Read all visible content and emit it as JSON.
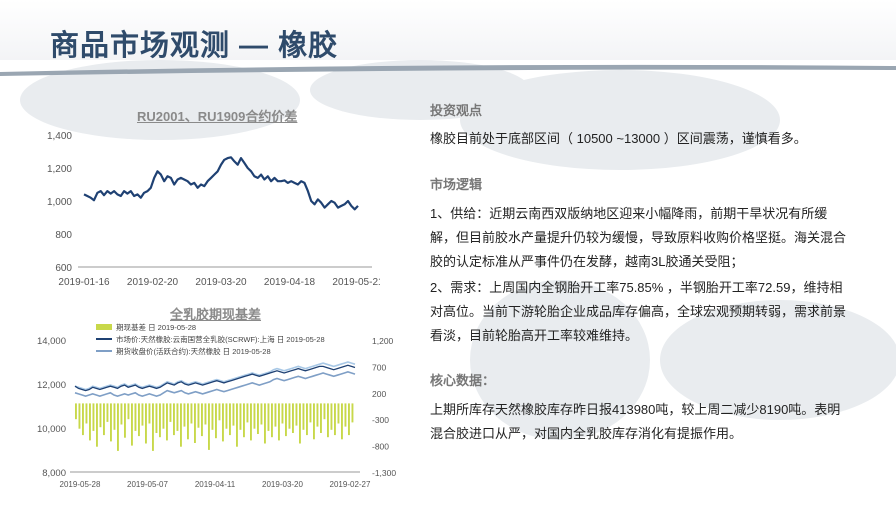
{
  "page": {
    "title": "商品市场观测 — 橡胶"
  },
  "colors": {
    "title": "#2f4b6b",
    "line_dark": "#1f4173",
    "line_mid": "#7f9fc6",
    "line_light": "#a8c8e6",
    "bar": "#c8d84a"
  },
  "right_panel": {
    "view_heading": "投资观点",
    "view_text": "橡胶目前处于底部区间（ 10500 ~13000 ）区间震荡，谨慎看多。",
    "logic_heading": "市场逻辑",
    "logic_p1": "1、供给：近期云南西双版纳地区迎来小幅降雨，前期干旱状况有所缓解，但目前胶水产量提升仍较为缓慢，导致原料收购价格坚挺。海关混合胶的认定标准从严事件仍在发酵，越南3L胶通关受阻；",
    "logic_p2": "2、需求：上周国内全钢胎开工率75.85% ，半钢胎开工率72.59，维持相对高位。当前下游轮胎企业成品库存偏高，全球宏观预期转弱，需求前景看淡，目前轮胎高开工率较难维持。",
    "core_heading": "核心数据：",
    "core_text": "上期所库存天然橡胶库存昨日报413980吨，较上周二减少8190吨。表明混合胶进口从严，对国内全乳胶库存消化有提振作用。"
  },
  "chart_data": [
    {
      "type": "line",
      "title": "RU2001、RU1909合约价差",
      "yticks": [
        "1,400",
        "1,200",
        "1,000",
        "800",
        "600"
      ],
      "ylim": [
        600,
        1400
      ],
      "xticks": [
        "2019-01-16",
        "2019-02-20",
        "2019-03-20",
        "2019-04-18",
        "2019-05-21"
      ],
      "series": [
        {
          "values": [
            1040,
            1030,
            1020,
            1005,
            1050,
            1060,
            1035,
            1060,
            1045,
            1060,
            1040,
            1030,
            1060,
            1045,
            1060,
            1030,
            1040,
            1020,
            1050,
            1060,
            1080,
            1140,
            1180,
            1160,
            1120,
            1150,
            1140,
            1100,
            1130,
            1140,
            1130,
            1120,
            1100,
            1110,
            1080,
            1100,
            1090,
            1120,
            1140,
            1160,
            1180,
            1220,
            1250,
            1260,
            1265,
            1240,
            1220,
            1260,
            1230,
            1200,
            1180,
            1150,
            1140,
            1160,
            1130,
            1150,
            1120,
            1140,
            1120,
            1120,
            1125,
            1110,
            1120,
            1110,
            1100,
            1120,
            1110,
            1060,
            1000,
            980,
            1010,
            990,
            960,
            980,
            1000,
            990,
            960,
            970,
            980,
            1000,
            970,
            950,
            970
          ]
        }
      ]
    },
    {
      "type": "bar",
      "title": "全乳胶期现基差",
      "legend": [
        "期现基差 日 2019-05-28",
        "市场价:天然橡胶:云南国营全乳胶(SCRWF):上海 日 2019-05-28",
        "期货收盘价(活跃合约):天然橡胶 日 2019-05-28"
      ],
      "yticks_left": [
        "14,000",
        "12,000",
        "10,000",
        "8,000"
      ],
      "ylim_left": [
        8000,
        14000
      ],
      "yticks_right": [
        "1,200",
        "700",
        "200",
        "-300",
        "-800",
        "-1,300"
      ],
      "ylim_right": [
        -1300,
        1200
      ],
      "xticks": [
        "2019-05-28",
        "2019-05-07",
        "2019-04-11",
        "2019-03-20",
        "2019-02-27"
      ],
      "bars": [
        -300,
        -480,
        -600,
        -380,
        -700,
        -520,
        -820,
        -450,
        -600,
        -350,
        -720,
        -500,
        -900,
        -400,
        -650,
        -300,
        -800,
        -520,
        -620,
        -420,
        -760,
        -380,
        -900,
        -560,
        -640,
        -480,
        -700,
        -350,
        -600,
        -520,
        -820,
        -440,
        -680,
        -380,
        -750,
        -460,
        -620,
        -400,
        -880,
        -500,
        -660,
        -320,
        -720,
        -480,
        -600,
        -420,
        -820,
        -500,
        -640,
        -360,
        -700,
        -480,
        -580,
        -400,
        -760,
        -520,
        -640,
        -440,
        -700,
        -380,
        -620,
        -480,
        -560,
        -420,
        -760,
        -500,
        -600,
        -360,
        -680,
        -440,
        -560,
        -300,
        -640,
        -500,
        -600,
        -380,
        -680,
        -440,
        -600,
        -360
      ],
      "series": [
        {
          "name": "市场价:天然橡胶:云南国营全乳胶(SCRWF):上海 日 2019-05-28",
          "values": [
            11600,
            11550,
            11500,
            11450,
            11500,
            11550,
            11500,
            11450,
            11500,
            11550,
            11600,
            11500,
            11450,
            11500,
            11550,
            11500,
            11550,
            11600,
            11500,
            11450,
            11500,
            11550,
            11500,
            11450,
            11500,
            11600,
            11700,
            11650,
            11600,
            11650,
            11700,
            11600,
            11550,
            11600,
            11650,
            11600,
            11550,
            11600,
            11650,
            11700,
            11750,
            11700,
            11650,
            11700,
            11750,
            11800,
            11850,
            11900,
            11950,
            12000,
            12050,
            12000,
            11950,
            12000,
            12050,
            12100,
            12200,
            12250,
            12200,
            12150,
            12200,
            12250,
            12300,
            12350,
            12300,
            12250,
            12300,
            12350,
            12400,
            12450,
            12500,
            12450,
            12400,
            12350,
            12400,
            12450,
            12500,
            12550,
            12500,
            12450
          ]
        },
        {
          "name": "期货收盘价(活跃合约):天然橡胶 日 2019-05-28",
          "values": [
            11900,
            11850,
            11800,
            11750,
            11800,
            11900,
            11850,
            11800,
            11850,
            11900,
            11950,
            11900,
            11850,
            11950,
            12000,
            11900,
            11950,
            12000,
            11900,
            11850,
            11900,
            11950,
            11900,
            11850,
            11900,
            12000,
            12100,
            12050,
            12000,
            12100,
            12150,
            12050,
            12000,
            12050,
            12100,
            12050,
            12000,
            12050,
            12100,
            12150,
            12200,
            12150,
            12100,
            12150,
            12200,
            12250,
            12300,
            12350,
            12400,
            12450,
            12500,
            12450,
            12400,
            12450,
            12500,
            12550,
            12650,
            12700,
            12650,
            12600,
            12650,
            12700,
            12750,
            12800,
            12750,
            12700,
            12750,
            12800,
            12850,
            12900,
            12950,
            12900,
            12850,
            12800,
            12850,
            12900,
            12950,
            13000,
            12950,
            12900
          ]
        },
        {
          "name": "",
          "values": [
            11900,
            11800,
            11750,
            11700,
            11750,
            11850,
            11800,
            11750,
            11800,
            11850,
            11900,
            11850,
            11800,
            11900,
            11950,
            11850,
            11900,
            11950,
            11850,
            11800,
            11850,
            11900,
            11850,
            11800,
            11850,
            11950,
            12050,
            12000,
            11950,
            12050,
            12100,
            12000,
            11950,
            12000,
            12050,
            12000,
            11950,
            12000,
            12050,
            12100,
            12150,
            12100,
            12050,
            12100,
            12150,
            12200,
            12250,
            12300,
            12350,
            12400,
            12450,
            12400,
            12350,
            12400,
            12450,
            12500,
            12550,
            12600,
            12550,
            12500,
            12550,
            12600,
            12650,
            12700,
            12650,
            12600,
            12650,
            12700,
            12750,
            12800,
            12800,
            12750,
            12700,
            12650,
            12700,
            12750,
            12800,
            12850,
            12800,
            12750
          ]
        }
      ]
    }
  ]
}
